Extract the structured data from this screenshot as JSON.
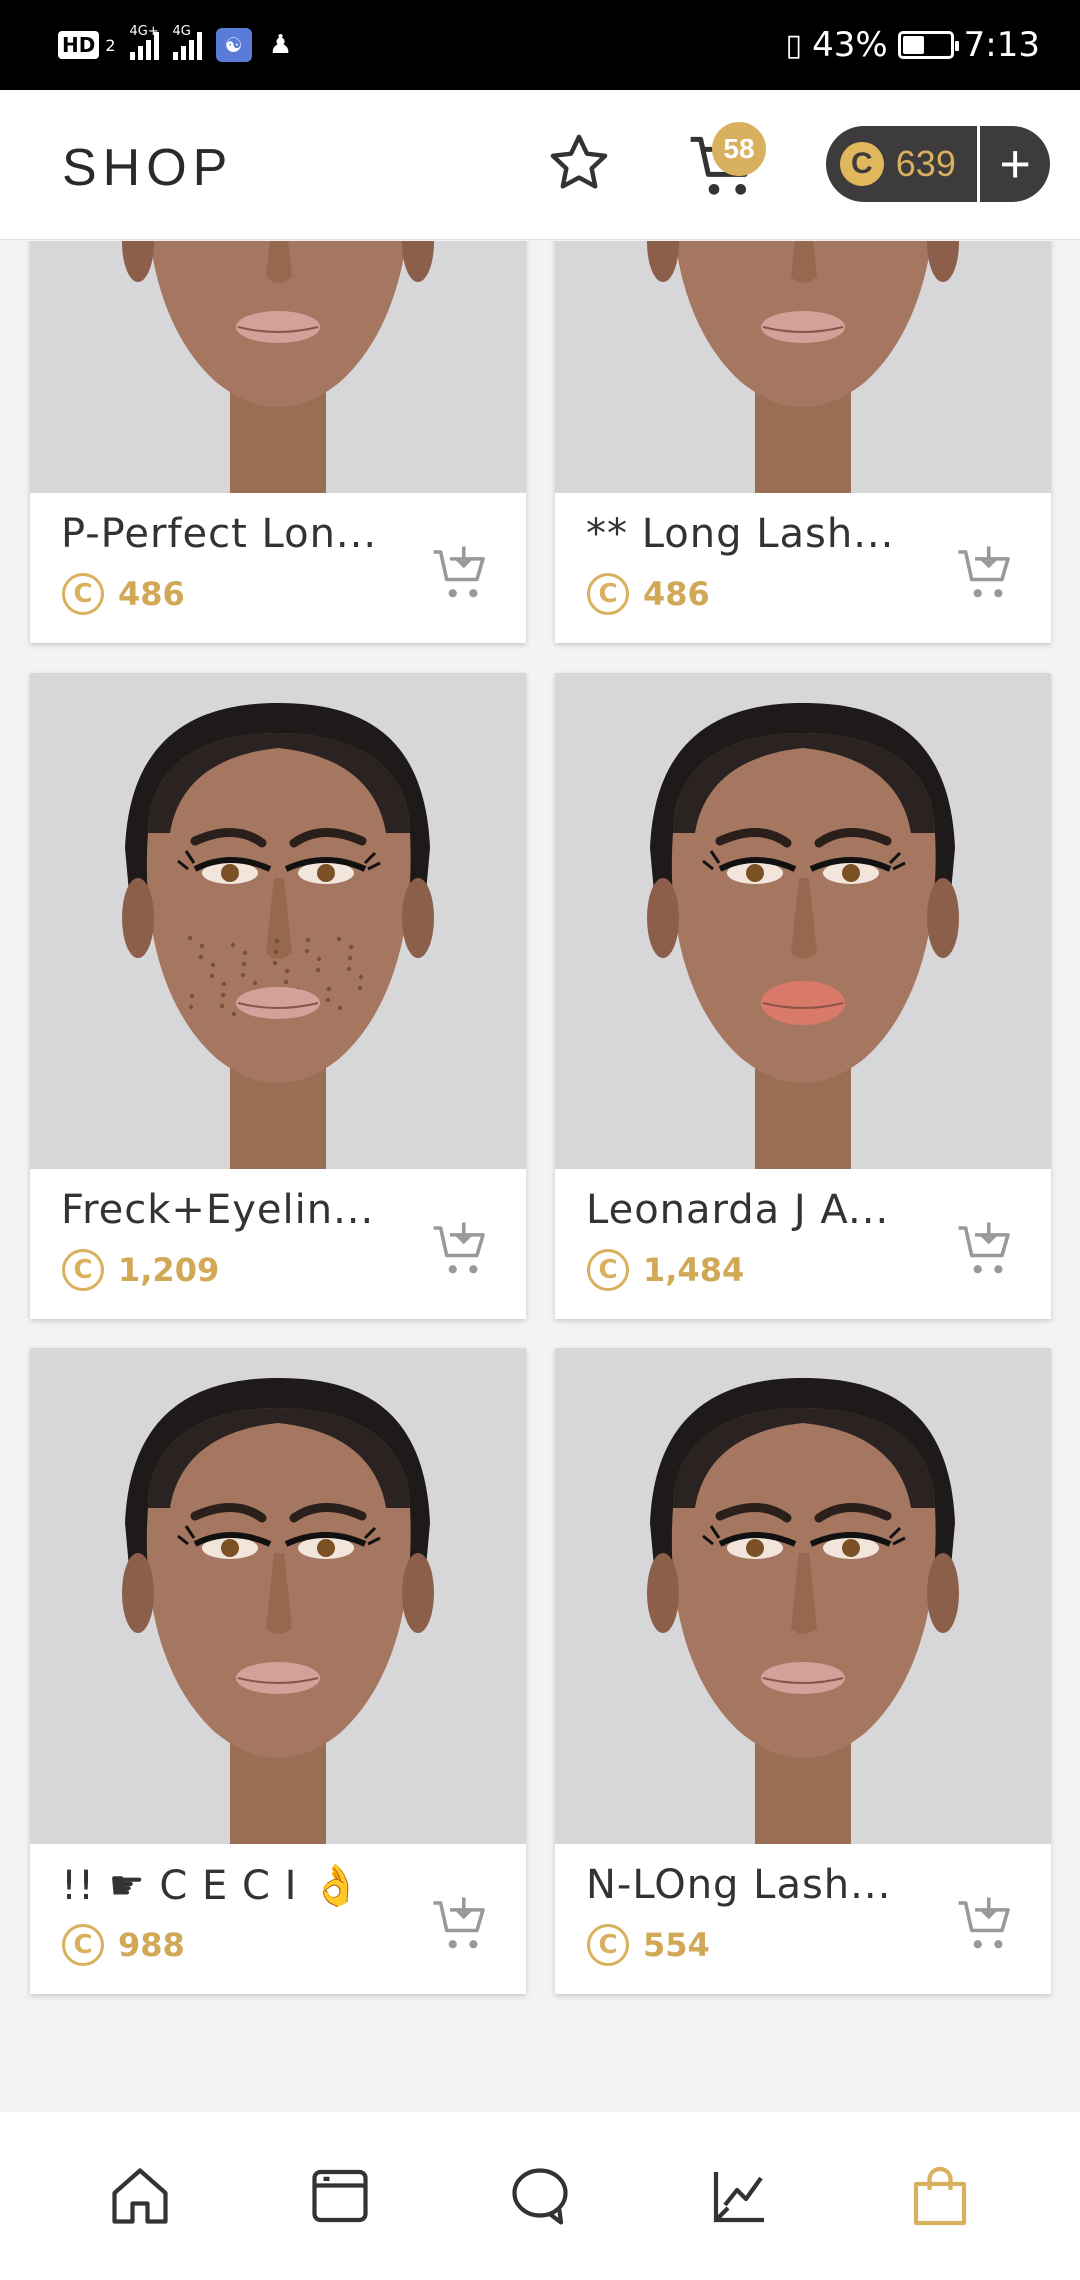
{
  "status_bar": {
    "hd_label": "HD",
    "hd_sub": "2",
    "net1": "4G+",
    "net2": "4G",
    "battery": "43%",
    "battery_level": 0.43,
    "time": "7:13"
  },
  "header": {
    "title": "SHOP",
    "cart_count": "58",
    "coin_symbol": "C",
    "coin_balance": "639",
    "add_coins_label": "+"
  },
  "products": [
    {
      "name": "P-Perfect Lon...",
      "price": "486",
      "coin": "C",
      "variant": "lashes"
    },
    {
      "name": "** Long Lash...",
      "price": "486",
      "coin": "C",
      "variant": "lashes"
    },
    {
      "name": "Freck+Eyelin...",
      "price": "1,209",
      "coin": "C",
      "variant": "freckles"
    },
    {
      "name": "Leonarda J A...",
      "price": "1,484",
      "coin": "C",
      "variant": "lips"
    },
    {
      "name": "!!  ☛ C E C I 👌",
      "price": "988",
      "coin": "C",
      "variant": "lashes"
    },
    {
      "name": "N-LOng Lash...",
      "price": "554",
      "coin": "C",
      "variant": "lashes"
    }
  ],
  "tabbar": {
    "items": [
      "home-icon",
      "feed-icon",
      "chat-icon",
      "activity-icon",
      "shop-icon"
    ],
    "active": "shop-icon",
    "active_color": "#d9b05e"
  },
  "colors": {
    "accent": "#d9b05e",
    "dark_pill": "#3d3b3c",
    "image_bg": "#d7d6d8"
  }
}
